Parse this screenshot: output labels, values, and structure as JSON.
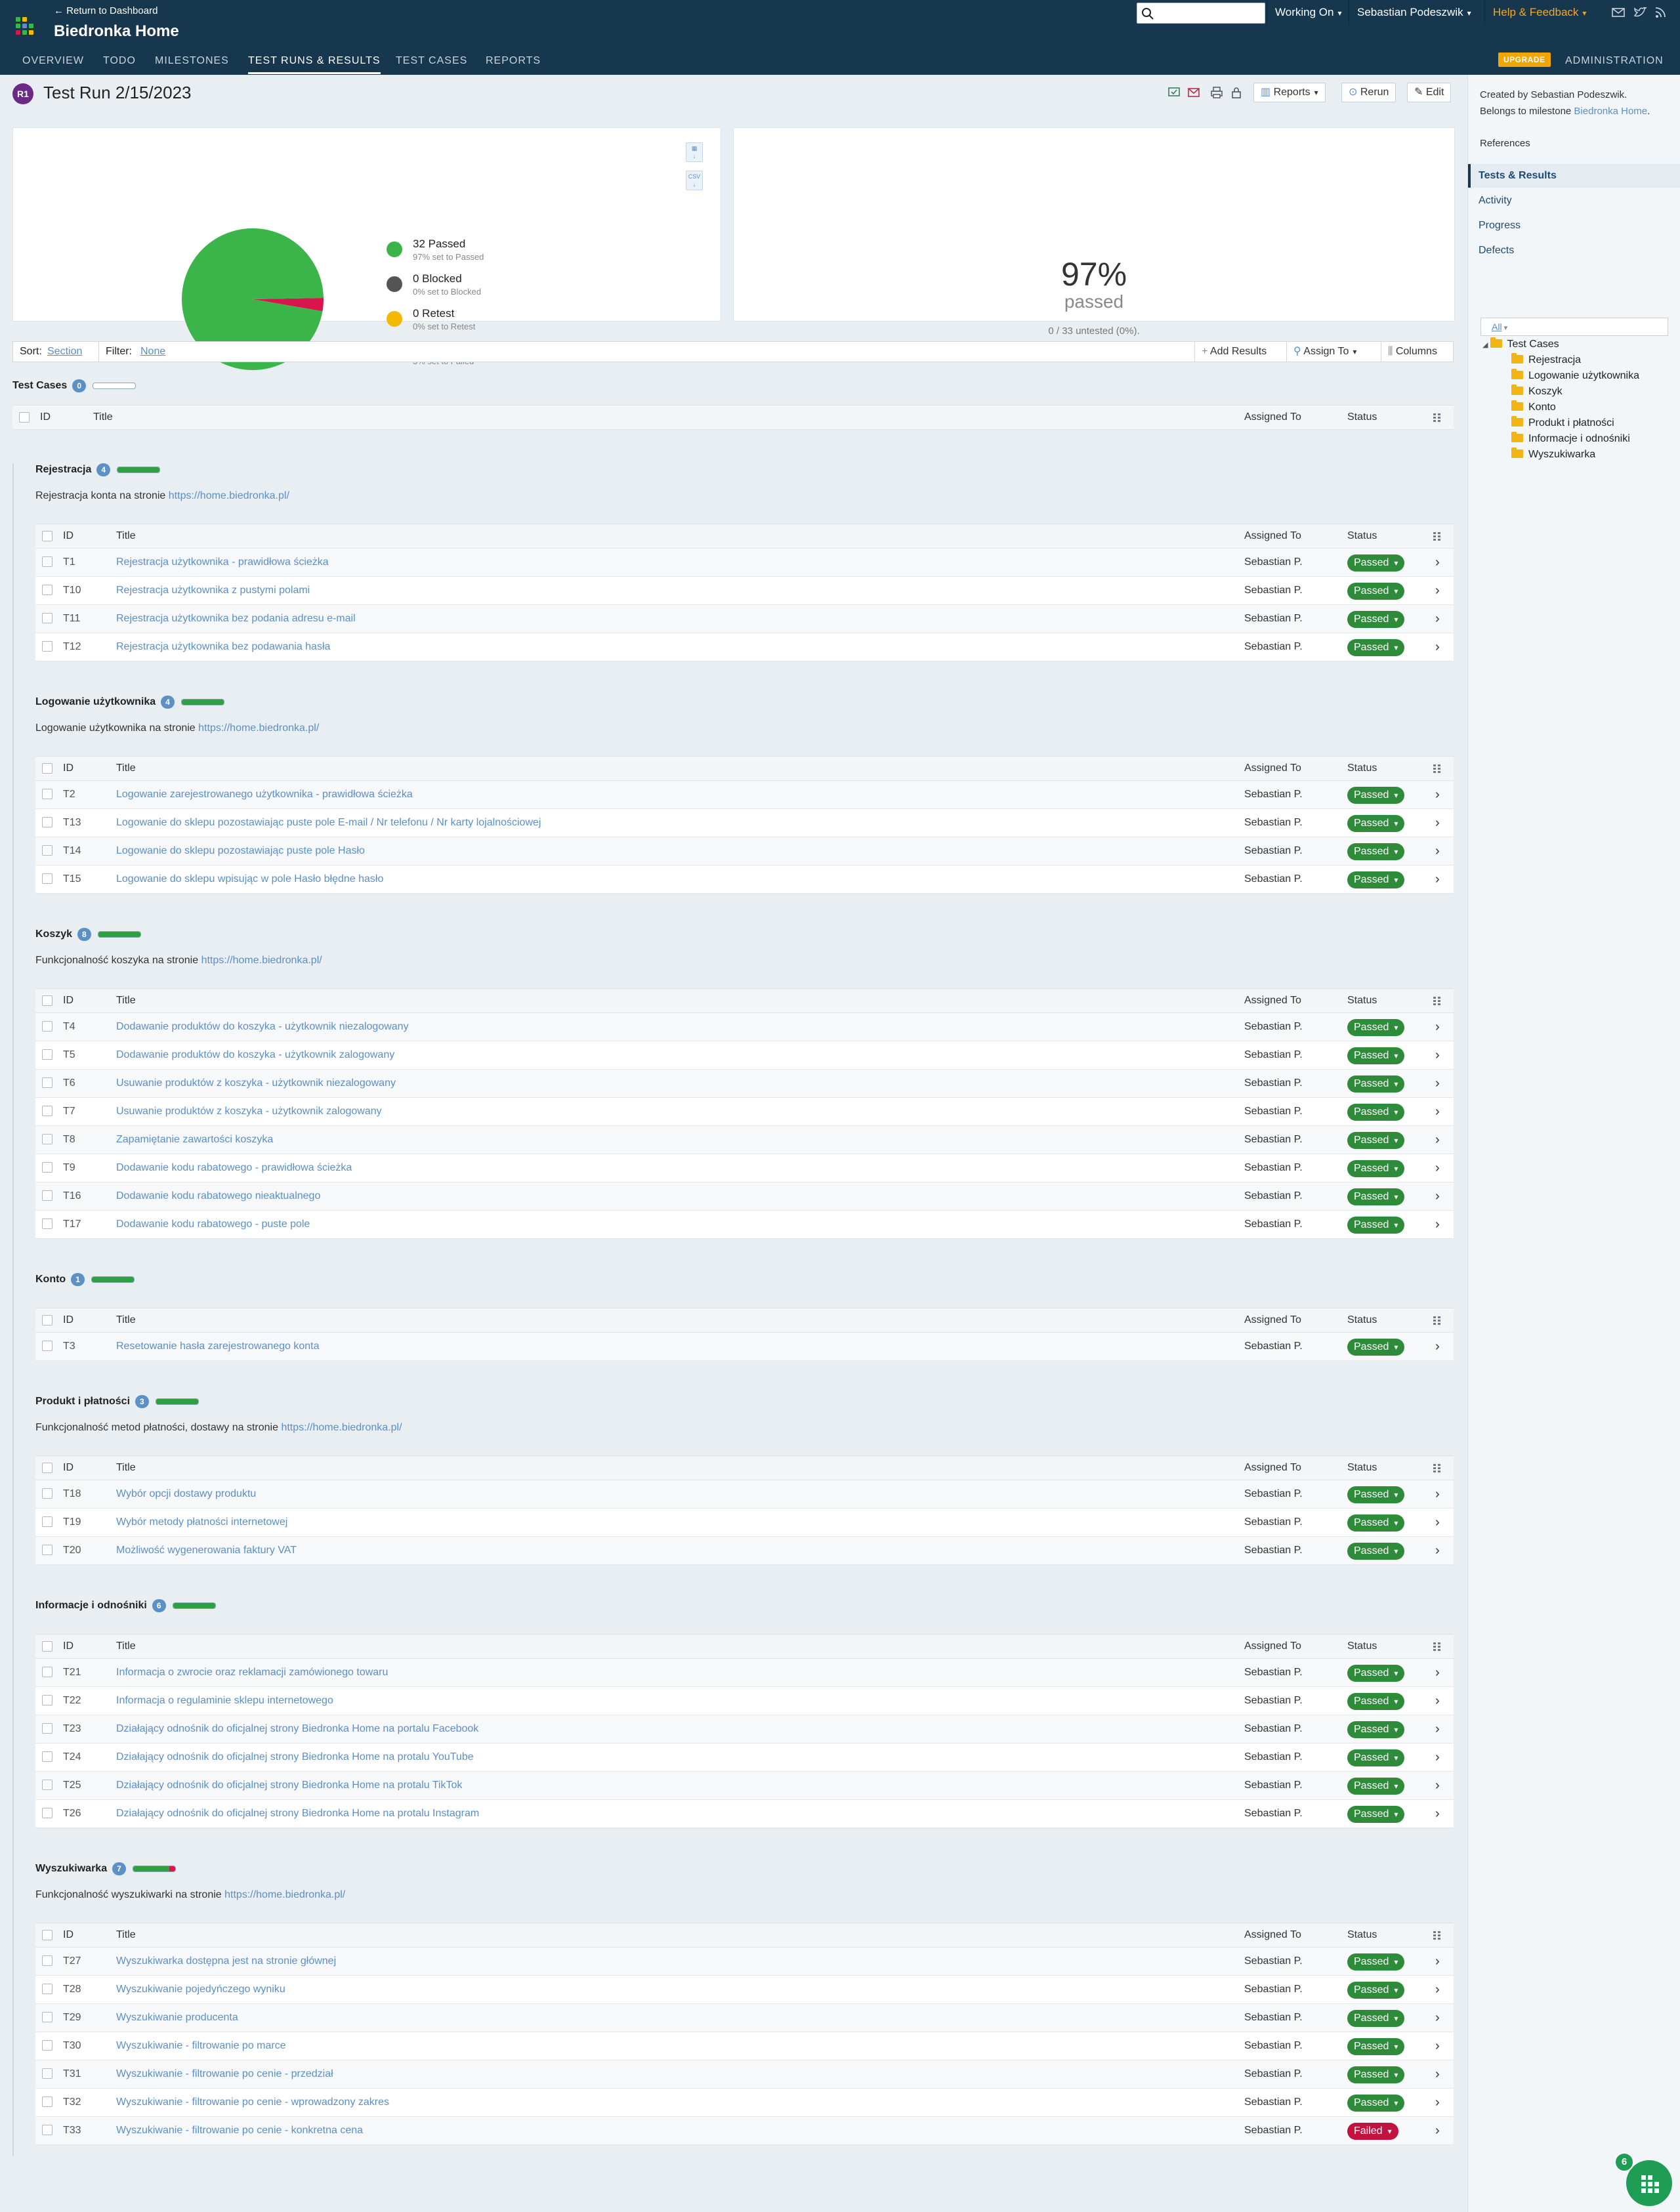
{
  "header": {
    "return_link": "← Return to Dashboard",
    "project": "Biedronka Home",
    "search_placeholder": "",
    "working_on": "Working On",
    "user": "Sebastian Podeszwik",
    "help": "Help & Feedback",
    "upgrade": "UPGRADE",
    "admin": "ADMINISTRATION",
    "tabs": [
      "OVERVIEW",
      "TODO",
      "MILESTONES",
      "TEST RUNS & RESULTS",
      "TEST CASES",
      "REPORTS"
    ]
  },
  "run": {
    "badge": "R1",
    "title": "Test Run 2/15/2023",
    "reports_btn": "Reports",
    "rerun_btn": "Rerun",
    "edit_btn": "Edit"
  },
  "summary": {
    "legend": [
      {
        "label": "32 Passed",
        "sub": "97% set to Passed",
        "color": "#3bb54a"
      },
      {
        "label": "0 Blocked",
        "sub": "0% set to Blocked",
        "color": "#555555"
      },
      {
        "label": "0 Retest",
        "sub": "0% set to Retest",
        "color": "#f5b800"
      },
      {
        "label": "1 Failed",
        "sub": "3% set to Failed",
        "color": "#d6164c"
      }
    ],
    "chart_data": {
      "type": "pie",
      "categories": [
        "Passed",
        "Blocked",
        "Retest",
        "Failed"
      ],
      "values": [
        32,
        0,
        0,
        1
      ]
    },
    "percent": "97%",
    "percent_label": "passed",
    "untested": "0 / 33 untested (0%).",
    "dl_chart": "",
    "dl_csv": "CSV"
  },
  "toolbar": {
    "sort_label": "Sort:",
    "sort_value": "Section",
    "filter_label": "Filter:",
    "filter_value": "None",
    "add_results": "Add Results",
    "assign_to": "Assign To",
    "columns": "Columns"
  },
  "columns": {
    "id": "ID",
    "title": "Title",
    "assigned": "Assigned To",
    "status": "Status"
  },
  "root": {
    "name": "Test Cases",
    "count": "0"
  },
  "sections": [
    {
      "name": "Rejestracja",
      "count": "4",
      "failed": 0,
      "desc": "Rejestracja konta na stronie",
      "link": "https://home.biedronka.pl/",
      "rows": [
        {
          "id": "T1",
          "title": "Rejestracja użytkownika - prawidłowa ścieżka",
          "assigned": "Sebastian P.",
          "status": "Passed"
        },
        {
          "id": "T10",
          "title": "Rejestracja użytkownika z pustymi polami",
          "assigned": "Sebastian P.",
          "status": "Passed"
        },
        {
          "id": "T11",
          "title": "Rejestracja użytkownika bez podania adresu e-mail",
          "assigned": "Sebastian P.",
          "status": "Passed"
        },
        {
          "id": "T12",
          "title": "Rejestracja użytkownika bez podawania hasła",
          "assigned": "Sebastian P.",
          "status": "Passed"
        }
      ]
    },
    {
      "name": "Logowanie użytkownika",
      "count": "4",
      "failed": 0,
      "desc": "Logowanie użytkownika na stronie",
      "link": "https://home.biedronka.pl/",
      "rows": [
        {
          "id": "T2",
          "title": "Logowanie zarejestrowanego użytkownika - prawidłowa ścieżka",
          "assigned": "Sebastian P.",
          "status": "Passed"
        },
        {
          "id": "T13",
          "title": "Logowanie do sklepu pozostawiając puste pole E-mail / Nr telefonu / Nr karty lojalnościowej",
          "assigned": "Sebastian P.",
          "status": "Passed"
        },
        {
          "id": "T14",
          "title": "Logowanie do sklepu pozostawiając puste pole Hasło",
          "assigned": "Sebastian P.",
          "status": "Passed"
        },
        {
          "id": "T15",
          "title": "Logowanie do sklepu wpisując w pole Hasło błędne hasło",
          "assigned": "Sebastian P.",
          "status": "Passed"
        }
      ]
    },
    {
      "name": "Koszyk",
      "count": "8",
      "failed": 0,
      "desc": "Funkcjonalność koszyka na stronie",
      "link": "https://home.biedronka.pl/",
      "rows": [
        {
          "id": "T4",
          "title": "Dodawanie produktów do koszyka - użytkownik niezalogowany",
          "assigned": "Sebastian P.",
          "status": "Passed"
        },
        {
          "id": "T5",
          "title": "Dodawanie produktów do koszyka - użytkownik zalogowany",
          "assigned": "Sebastian P.",
          "status": "Passed"
        },
        {
          "id": "T6",
          "title": "Usuwanie produktów z koszyka - użytkownik niezalogowany",
          "assigned": "Sebastian P.",
          "status": "Passed"
        },
        {
          "id": "T7",
          "title": "Usuwanie produktów z koszyka - użytkownik zalogowany",
          "assigned": "Sebastian P.",
          "status": "Passed"
        },
        {
          "id": "T8",
          "title": "Zapamiętanie zawartości koszyka",
          "assigned": "Sebastian P.",
          "status": "Passed"
        },
        {
          "id": "T9",
          "title": "Dodawanie kodu rabatowego - prawidłowa ścieżka",
          "assigned": "Sebastian P.",
          "status": "Passed"
        },
        {
          "id": "T16",
          "title": "Dodawanie kodu rabatowego nieaktualnego",
          "assigned": "Sebastian P.",
          "status": "Passed"
        },
        {
          "id": "T17",
          "title": "Dodawanie kodu rabatowego - puste pole",
          "assigned": "Sebastian P.",
          "status": "Passed"
        }
      ]
    },
    {
      "name": "Konto",
      "count": "1",
      "failed": 0,
      "desc": "",
      "link": "",
      "rows": [
        {
          "id": "T3",
          "title": "Resetowanie hasła zarejestrowanego konta",
          "assigned": "Sebastian P.",
          "status": "Passed"
        }
      ]
    },
    {
      "name": "Produkt i płatności",
      "count": "3",
      "failed": 0,
      "desc": "Funkcjonalność metod płatności, dostawy na stronie",
      "link": "https://home.biedronka.pl/",
      "rows": [
        {
          "id": "T18",
          "title": "Wybór opcji dostawy produktu",
          "assigned": "Sebastian P.",
          "status": "Passed"
        },
        {
          "id": "T19",
          "title": "Wybór metody płatności internetowej",
          "assigned": "Sebastian P.",
          "status": "Passed"
        },
        {
          "id": "T20",
          "title": "Możliwość wygenerowania faktury VAT",
          "assigned": "Sebastian P.",
          "status": "Passed"
        }
      ]
    },
    {
      "name": "Informacje i odnośniki",
      "count": "6",
      "failed": 0,
      "desc": "",
      "link": "",
      "rows": [
        {
          "id": "T21",
          "title": "Informacja o zwrocie oraz reklamacji zamówionego towaru",
          "assigned": "Sebastian P.",
          "status": "Passed"
        },
        {
          "id": "T22",
          "title": "Informacja o regulaminie sklepu internetowego",
          "assigned": "Sebastian P.",
          "status": "Passed"
        },
        {
          "id": "T23",
          "title": "Działający odnośnik do oficjalnej strony Biedronka Home na portalu Facebook",
          "assigned": "Sebastian P.",
          "status": "Passed"
        },
        {
          "id": "T24",
          "title": "Działający odnośnik do oficjalnej strony Biedronka Home na protalu YouTube",
          "assigned": "Sebastian P.",
          "status": "Passed"
        },
        {
          "id": "T25",
          "title": "Działający odnośnik do oficjalnej strony Biedronka Home na protalu TikTok",
          "assigned": "Sebastian P.",
          "status": "Passed"
        },
        {
          "id": "T26",
          "title": "Działający odnośnik do oficjalnej strony Biedronka Home na protalu Instagram",
          "assigned": "Sebastian P.",
          "status": "Passed"
        }
      ]
    },
    {
      "name": "Wyszukiwarka",
      "count": "7",
      "failed": 1,
      "desc": "Funkcjonalność wyszukiwarki na stronie",
      "link": "https://home.biedronka.pl/",
      "rows": [
        {
          "id": "T27",
          "title": "Wyszukiwarka dostępna jest na stronie głównej",
          "assigned": "Sebastian P.",
          "status": "Passed"
        },
        {
          "id": "T28",
          "title": "Wyszukiwanie pojedyńczego wyniku",
          "assigned": "Sebastian P.",
          "status": "Passed"
        },
        {
          "id": "T29",
          "title": "Wyszukiwanie producenta",
          "assigned": "Sebastian P.",
          "status": "Passed"
        },
        {
          "id": "T30",
          "title": "Wyszukiwanie - filtrowanie po marce",
          "assigned": "Sebastian P.",
          "status": "Passed"
        },
        {
          "id": "T31",
          "title": "Wyszukiwanie - filtrowanie po cenie - przedział",
          "assigned": "Sebastian P.",
          "status": "Passed"
        },
        {
          "id": "T32",
          "title": "Wyszukiwanie - filtrowanie po cenie - wprowadzony zakres",
          "assigned": "Sebastian P.",
          "status": "Passed"
        },
        {
          "id": "T33",
          "title": "Wyszukiwanie - filtrowanie po cenie - konkretna cena",
          "assigned": "Sebastian P.",
          "status": "Failed"
        }
      ]
    }
  ],
  "status_colors": {
    "Passed": "#2e8b3a",
    "Failed": "#c2123f"
  },
  "sidebar": {
    "created_by": "Created by Sebastian Podeszwik.",
    "belongs_prefix": "Belongs to milestone",
    "milestone": "Biedronka Home",
    "milestone_suffix": ".",
    "references": "References",
    "nav": [
      "Tests & Results",
      "Activity",
      "Progress",
      "Defects"
    ],
    "tree_filter": "All",
    "tree_root": "Test Cases",
    "tree_items": [
      "Rejestracja",
      "Logowanie użytkownika",
      "Koszyk",
      "Konto",
      "Produkt i płatności",
      "Informacje i odnośniki",
      "Wyszukiwarka"
    ]
  },
  "fab_count": "6"
}
